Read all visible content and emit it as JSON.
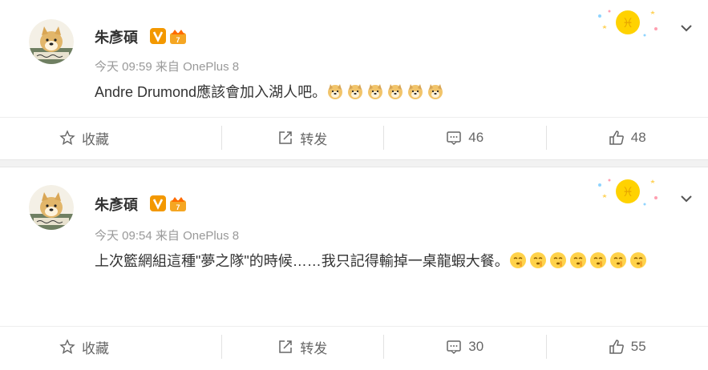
{
  "posts": [
    {
      "author": "朱彥碩",
      "time": "今天 09:59",
      "source_prefix": "来自",
      "source": "OnePlus 8",
      "text": "Andre Drumond應該會加入湖人吧。",
      "emoji_count": 6,
      "emoji_type": "doge",
      "actions": {
        "favorite": "收藏",
        "repost": "转发",
        "comments": "46",
        "likes": "48"
      }
    },
    {
      "author": "朱彥碩",
      "time": "今天 09:54",
      "source_prefix": "来自",
      "source": "OnePlus 8",
      "text": "上次籃網組這種\"夢之隊\"的時候……我只記得輸掉一桌龍蝦大餐。",
      "emoji_count": 7,
      "emoji_type": "shush",
      "actions": {
        "favorite": "收藏",
        "repost": "转发",
        "comments": "30",
        "likes": "55"
      }
    }
  ],
  "colors": {
    "accent": "#ff8200",
    "muted": "#999999",
    "text": "#333333",
    "divider": "#f2f2f2"
  }
}
